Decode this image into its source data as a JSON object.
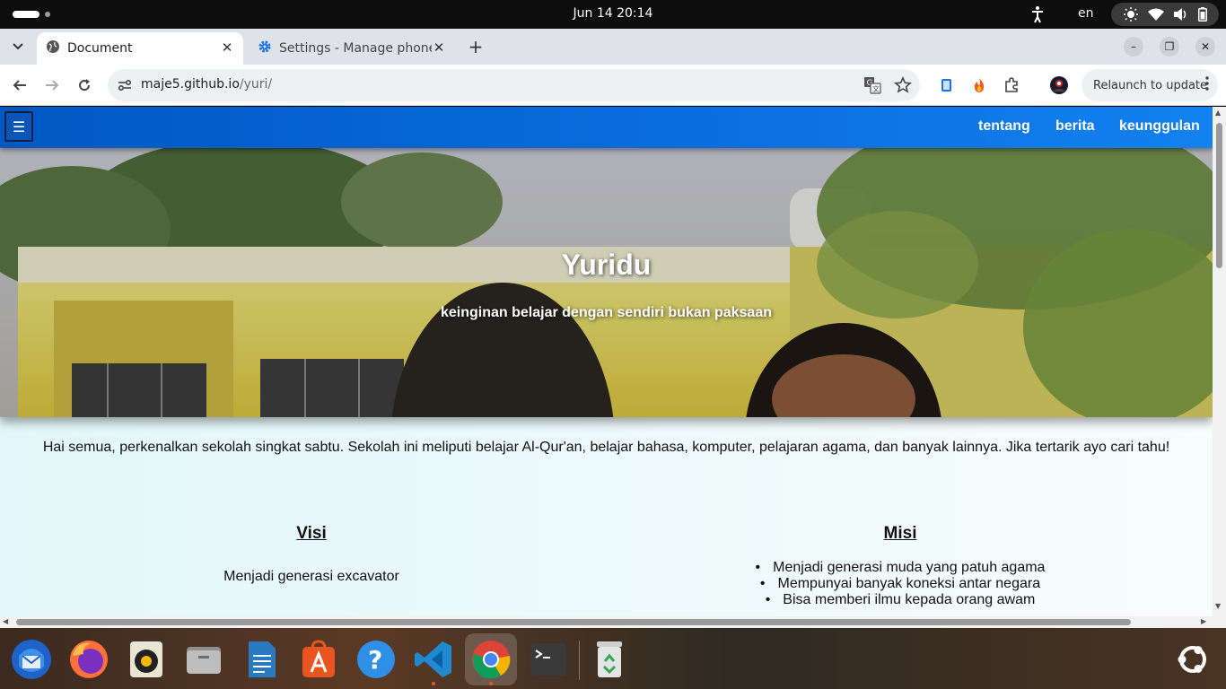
{
  "topbar": {
    "clock": "Jun 14  20:14",
    "language": "en",
    "icons": [
      "accessibility-icon",
      "brightness-icon",
      "wifi-icon",
      "volume-icon",
      "battery-icon"
    ]
  },
  "browser": {
    "tabs": [
      {
        "title": "Document",
        "icon": "globe-icon",
        "active": true
      },
      {
        "title": "Settings - Manage phone",
        "icon": "gear-icon",
        "active": false
      }
    ],
    "address": {
      "host": "maje5.github.io",
      "path": "/yuri/"
    },
    "relaunch_label": "Relaunch to update",
    "accent": "#1a73e8"
  },
  "page": {
    "menu_icon": "☰",
    "nav": [
      "tentang",
      "berita",
      "keunggulan"
    ],
    "hero": {
      "title": "Yuridu",
      "subtitle": "keinginan belajar dengan sendiri bukan paksaan"
    },
    "intro": "Hai semua, perkenalkan sekolah singkat sabtu. Sekolah ini meliputi belajar Al-Qur'an, belajar bahasa, komputer, pelajaran agama, dan banyak lainnya. Jika tertarik ayo cari tahu!",
    "visi": {
      "heading": "Visi",
      "text": "Menjadi generasi excavator"
    },
    "misi": {
      "heading": "Misi",
      "items": [
        "Menjadi generasi muda yang patuh agama",
        "Mempunyai banyak koneksi antar negara",
        "Bisa memberi ilmu kepada orang awam"
      ]
    },
    "navbar_color": "#0b6fe0"
  },
  "dock": {
    "apps": [
      "thunderbird-icon",
      "firefox-icon",
      "rhythmbox-icon",
      "files-icon",
      "writer-icon",
      "app-center-icon",
      "help-icon",
      "vscode-icon",
      "chrome-icon",
      "terminal-icon",
      "trash-icon",
      "show-apps-icon"
    ]
  }
}
